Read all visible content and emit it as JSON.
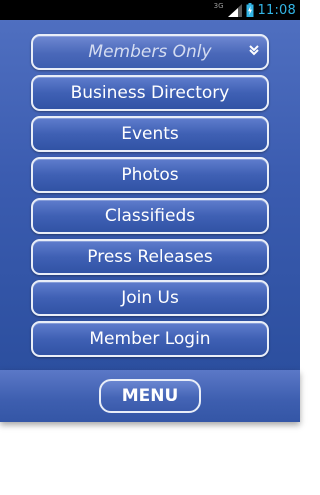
{
  "status_bar": {
    "network_type": "3G",
    "time": "11:08",
    "icons": [
      "signal-icon",
      "battery-charging-icon"
    ]
  },
  "menu_items": {
    "members_only": "Members Only",
    "business_directory": "Business Directory",
    "events": "Events",
    "photos": "Photos",
    "classifieds": "Classifieds",
    "press_releases": "Press Releases",
    "join_us": "Join Us",
    "member_login": "Member Login"
  },
  "footer": {
    "menu_label": "MENU"
  },
  "colors": {
    "status_bar_bg": "#000000",
    "clock_color": "#33b5e5",
    "panel_blue": "#3b5cb0",
    "button_border": "#e9eef8",
    "button_text": "#ffffff"
  }
}
